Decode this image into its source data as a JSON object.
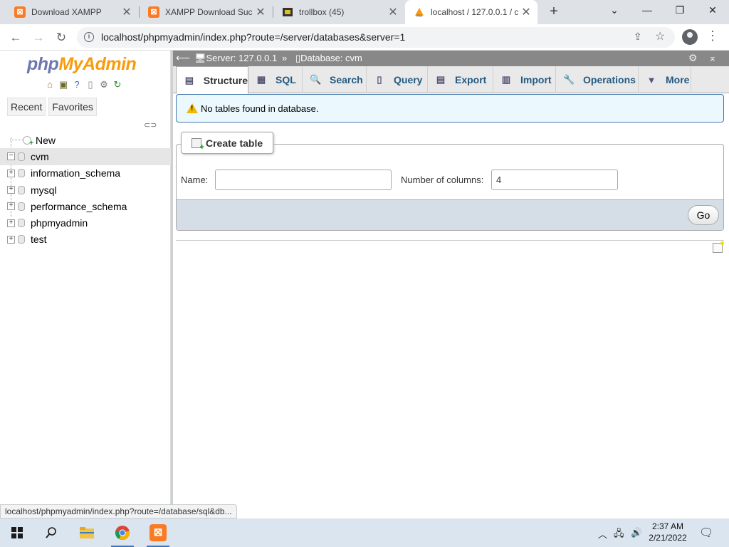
{
  "browser": {
    "tabs": [
      {
        "title": "Download XAMPP",
        "icon": "xampp-icon"
      },
      {
        "title": "XAMPP Download Suc",
        "icon": "xampp-icon"
      },
      {
        "title": "trollbox (45)",
        "icon": "trollbox-icon"
      },
      {
        "title": "localhost / 127.0.0.1 / c",
        "icon": "pma-icon",
        "active": true
      }
    ],
    "new_tab": "+",
    "url": "localhost/phpmyadmin/index.php?route=/server/databases&server=1"
  },
  "nav": {
    "logo_php": "php",
    "logo_myadmin": "MyAdmin",
    "tabs": [
      "Recent",
      "Favorites"
    ],
    "tree": [
      {
        "label": "New",
        "kind": "new"
      },
      {
        "label": "cvm",
        "kind": "db",
        "selected": true
      },
      {
        "label": "information_schema",
        "kind": "db"
      },
      {
        "label": "mysql",
        "kind": "db"
      },
      {
        "label": "performance_schema",
        "kind": "db"
      },
      {
        "label": "phpmyadmin",
        "kind": "db"
      },
      {
        "label": "test",
        "kind": "db"
      }
    ]
  },
  "breadcrumb": {
    "server": "Server: 127.0.0.1",
    "separator": "»",
    "database": "Database: cvm"
  },
  "main_tabs": [
    {
      "label": "Structure",
      "icon": "structure-icon",
      "active": true
    },
    {
      "label": "SQL",
      "icon": "sql-icon"
    },
    {
      "label": "Search",
      "icon": "search-icon"
    },
    {
      "label": "Query",
      "icon": "query-icon"
    },
    {
      "label": "Export",
      "icon": "export-icon"
    },
    {
      "label": "Import",
      "icon": "import-icon"
    },
    {
      "label": "Operations",
      "icon": "wrench-icon"
    },
    {
      "label": "More",
      "icon": "triangle-down-icon"
    }
  ],
  "notice": "No tables found in database.",
  "create_table": {
    "legend": "Create table",
    "name_label": "Name:",
    "name_value": "",
    "columns_label": "Number of columns:",
    "columns_value": "4",
    "go_label": "Go"
  },
  "status_url": "localhost/phpmyadmin/index.php?route=/database/sql&db...",
  "taskbar": {
    "time": "2:37 AM",
    "date": "2/21/2022"
  }
}
